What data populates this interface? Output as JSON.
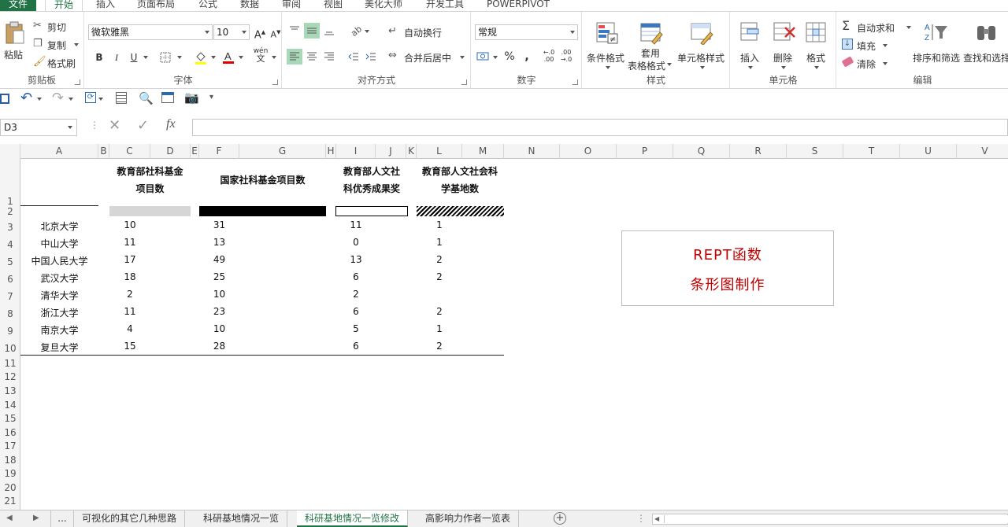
{
  "ribbon_tabs": [
    "文件",
    "开始",
    "插入",
    "页面布局",
    "公式",
    "数据",
    "审阅",
    "视图",
    "美化大师",
    "开发工具",
    "POWERPIVOT"
  ],
  "clipboard": {
    "paste": "粘贴",
    "cut": "剪切",
    "copy": "复制",
    "format_painter": "格式刷",
    "group": "剪贴板"
  },
  "font": {
    "name": "微软雅黑",
    "size": "10",
    "bold": "B",
    "italic": "I",
    "underline": "U",
    "wen": "wén",
    "group": "字体"
  },
  "alignment": {
    "wrap": "自动换行",
    "merge": "合并后居中",
    "group": "对齐方式"
  },
  "number": {
    "format": "常规",
    "percent": "%",
    "comma": ",",
    "group": "数字"
  },
  "styles": {
    "conditional": "条件格式",
    "table_1": "套用",
    "table_2": "表格格式",
    "cell_style": "单元格样式",
    "group": "样式"
  },
  "cells": {
    "insert": "插入",
    "delete": "删除",
    "format": "格式",
    "group": "单元格"
  },
  "editing": {
    "autosum": "自动求和",
    "fill": "填充",
    "clear": "清除",
    "sort": "排序和筛选",
    "find": "查找和选择",
    "group": "编辑"
  },
  "formula_bar": {
    "name_box": "D3",
    "value": ""
  },
  "columns": [
    "A",
    "B",
    "C",
    "D",
    "E",
    "F",
    "G",
    "H",
    "I",
    "J",
    "K",
    "L",
    "M",
    "N",
    "O",
    "P",
    "Q",
    "R",
    "S",
    "T",
    "U",
    "V"
  ],
  "rows": [
    "1",
    "2",
    "3",
    "4",
    "5",
    "6",
    "7",
    "8",
    "9",
    "10",
    "11",
    "12",
    "13",
    "14",
    "15",
    "16",
    "17",
    "18",
    "19",
    "20",
    "21"
  ],
  "table": {
    "headers": {
      "c1a": "教育部社科基金",
      "c1b": "项目数",
      "c2": "国家社科基金项目数",
      "c3a": "教育部人文社",
      "c3b": "科优秀成果奖",
      "c4a": "教育部人文社会科",
      "c4b": "学基地数"
    },
    "rows": [
      {
        "univ": "北京大学",
        "a": "10",
        "b": "31",
        "c": "11",
        "d": "1"
      },
      {
        "univ": "中山大学",
        "a": "11",
        "b": "13",
        "c": "0",
        "d": "1"
      },
      {
        "univ": "中国人民大学",
        "a": "17",
        "b": "49",
        "c": "13",
        "d": "2"
      },
      {
        "univ": "武汉大学",
        "a": "18",
        "b": "25",
        "c": "6",
        "d": "2"
      },
      {
        "univ": "清华大学",
        "a": "2",
        "b": "10",
        "c": "2",
        "d": ""
      },
      {
        "univ": "浙江大学",
        "a": "11",
        "b": "23",
        "c": "6",
        "d": "2"
      },
      {
        "univ": "南京大学",
        "a": "4",
        "b": "10",
        "c": "5",
        "d": "1"
      },
      {
        "univ": "复旦大学",
        "a": "15",
        "b": "28",
        "c": "6",
        "d": "2"
      }
    ]
  },
  "callout": {
    "line1": "REPT函数",
    "line2": "条形图制作"
  },
  "sheet_tabs": {
    "more": "...",
    "tabs": [
      "可视化的其它几种思路",
      "科研基地情况一览",
      "科研基地情况一览修改",
      "高影响力作者一览表"
    ],
    "active_index": 2
  },
  "colors": {
    "accent": "#217346",
    "callout_text": "#c00000"
  }
}
